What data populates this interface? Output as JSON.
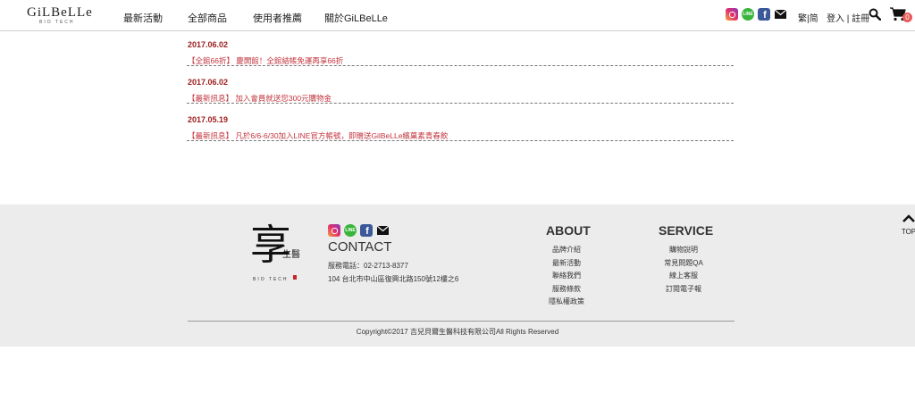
{
  "header": {
    "logo_main": "GiLBeLLe",
    "logo_sub": "BIO TECH",
    "nav": [
      "最新活動",
      "全部商品",
      "使用者推薦",
      "關於GiLBeLLe"
    ],
    "lang_trad": "繁",
    "lang_sep": "|",
    "lang_simp": "简",
    "login": "登入",
    "login_sep": "|",
    "register": "註冊",
    "cart_count": "0",
    "social_icons": [
      "instagram-icon",
      "line-icon",
      "facebook-icon",
      "mail-icon"
    ],
    "line_text": "LINE",
    "fb_text": "f"
  },
  "news": [
    {
      "date": "2017.06.02",
      "title": "【全館66折】 慶開館！全館結帳免運再享66折"
    },
    {
      "date": "2017.06.02",
      "title": "【最新訊息】 加入會員就送您300元購物金"
    },
    {
      "date": "2017.05.19",
      "title": "【最新訊息】 凡於6/6-6/30加入LINE官方帳號，即贈送GilBeLLe繽菓素青春飲"
    }
  ],
  "footer": {
    "brand_char": "享",
    "brand_small": "生醫",
    "brand_sub": "BIO TECH",
    "contact_title": "CONTACT",
    "phone": "服務電話：02-2713-8377",
    "address": "104 台北市中山區復興北路150號12樓之6",
    "about_title": "ABOUT",
    "about_links": [
      "品牌介紹",
      "最新活動",
      "聯絡我們",
      "服務條款",
      "隱私權政策"
    ],
    "service_title": "SERVICE",
    "service_links": [
      "購物說明",
      "常見問題QA",
      "線上客服",
      "訂閱電子報"
    ],
    "copyright": "Copyright©2017 吉兒貝爾生醫科技有限公司All Rights Reserved",
    "top_label": "TOP"
  },
  "colors": {
    "date": "#9b1c1c",
    "news_title": "#c2353e",
    "footer_bg": "#ececec",
    "badge": "#e85a5a"
  }
}
